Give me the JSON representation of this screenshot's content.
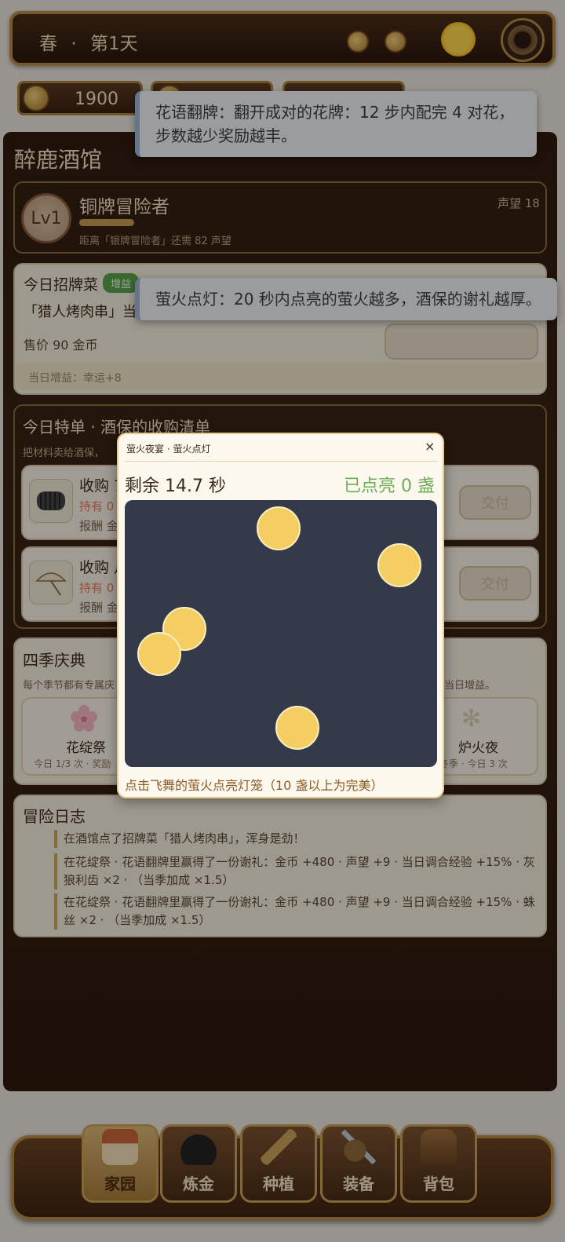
{
  "topbar": {
    "season": "春",
    "sep": "·",
    "day": "第1天"
  },
  "resources": {
    "gold": "1900"
  },
  "toasts": [
    "花语翻牌：翻开成对的花牌：12 步内配完 4 对花，步数越少奖励越丰。",
    "萤火点灯：20 秒内点亮的萤火越多，酒保的谢礼越厚。"
  ],
  "tavern": {
    "title": "醉鹿酒馆",
    "level": "Lv1",
    "rank": "铜牌冒险者",
    "rank_progress": 0.18,
    "fame": "声望 18",
    "next_rank_note": "距离「银牌冒险者」还需 82 声望"
  },
  "signature_dish": {
    "title": "今日招牌菜",
    "tag": "增益",
    "dish": "「猎人烤肉串」当",
    "price": "售价 90 金币",
    "buff": "当日增益：幸运+8"
  },
  "special_orders": {
    "title": "今日特单 · 酒保的收购清单",
    "subtitle": "把材料卖给酒保，",
    "items": [
      {
        "title": "收购 7",
        "held": "持有 0",
        "reward": "报酬 金",
        "button": "交付",
        "icon": "rope-bundle-icon"
      },
      {
        "title": "收购 月",
        "held": "持有 0",
        "reward": "报酬 金",
        "button": "交付",
        "icon": "umbrella-icon"
      }
    ]
  },
  "festival": {
    "title": "四季庆典",
    "subtitle_left": "每个季节都有专属庆",
    "subtitle_right": "当日增益。",
    "cards": [
      {
        "name": "花绽祭",
        "meta": "今日 1/3 次 · 奖励",
        "icon": "blossom-icon"
      },
      {
        "name": "炉火夜",
        "meta": "冬季 · 今日 3 次",
        "icon": "snowflake-icon"
      }
    ]
  },
  "log": {
    "title": "冒险日志",
    "entries": [
      "在酒馆点了招牌菜「猎人烤肉串」，浑身是劲！",
      "在花绽祭 · 花语翻牌里赢得了一份谢礼：金币 +480 · 声望 +9 · 当日调合经验 +15% · 灰狼利齿 ×2 · （当季加成 ×1.5）",
      "在花绽祭 · 花语翻牌里赢得了一份谢礼：金币 +480 · 声望 +9 · 当日调合经验 +15% · 蛛丝 ×2 · （当季加成 ×1.5）"
    ]
  },
  "modal": {
    "title": "萤火夜宴 · 萤火点灯",
    "close": "×",
    "timer": "剩余 14.7 秒",
    "lit": "已点亮 0 盏",
    "hint": "点击飞舞的萤火点亮灯笼（10 盏以上为完美）",
    "field_color": "#343a4a",
    "firefly_color": "#f4cd63"
  },
  "nav": {
    "items": [
      {
        "label": "家园",
        "icon": "house-icon",
        "active": true
      },
      {
        "label": "炼金",
        "icon": "cauldron-icon",
        "active": false
      },
      {
        "label": "种植",
        "icon": "wheat-icon",
        "active": false
      },
      {
        "label": "装备",
        "icon": "sword-shield-icon",
        "active": false
      },
      {
        "label": "背包",
        "icon": "backpack-icon",
        "active": false
      }
    ]
  }
}
